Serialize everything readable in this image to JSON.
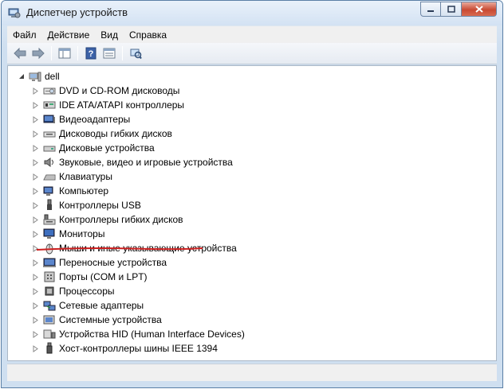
{
  "window": {
    "title": "Диспетчер устройств"
  },
  "menu": {
    "items": [
      "Файл",
      "Действие",
      "Вид",
      "Справка"
    ]
  },
  "toolbar": {
    "buttons": [
      "back-icon",
      "forward-icon",
      "console-tree-icon",
      "help-icon",
      "properties-icon",
      "scan-hardware-icon"
    ]
  },
  "tree": {
    "root": "dell",
    "items": [
      {
        "label": "DVD и CD-ROM дисководы",
        "icon": "dvd-drive-icon"
      },
      {
        "label": "IDE ATA/ATAPI контроллеры",
        "icon": "ide-controller-icon"
      },
      {
        "label": "Видеоадаптеры",
        "icon": "display-adapter-icon"
      },
      {
        "label": "Дисководы гибких дисков",
        "icon": "floppy-drive-icon"
      },
      {
        "label": "Дисковые устройства",
        "icon": "disk-drive-icon"
      },
      {
        "label": "Звуковые, видео и игровые устройства",
        "icon": "sound-icon"
      },
      {
        "label": "Клавиатуры",
        "icon": "keyboard-icon"
      },
      {
        "label": "Компьютер",
        "icon": "computer-icon"
      },
      {
        "label": "Контроллеры USB",
        "icon": "usb-icon"
      },
      {
        "label": "Контроллеры гибких дисков",
        "icon": "floppy-controller-icon"
      },
      {
        "label": "Мониторы",
        "icon": "monitor-icon"
      },
      {
        "label": "Мыши и иные указывающие устройства",
        "icon": "mouse-icon"
      },
      {
        "label": "Переносные устройства",
        "icon": "portable-device-icon"
      },
      {
        "label": "Порты (COM и LPT)",
        "icon": "port-icon"
      },
      {
        "label": "Процессоры",
        "icon": "processor-icon"
      },
      {
        "label": "Сетевые адаптеры",
        "icon": "network-adapter-icon"
      },
      {
        "label": "Системные устройства",
        "icon": "system-device-icon"
      },
      {
        "label": "Устройства HID (Human Interface Devices)",
        "icon": "hid-icon"
      },
      {
        "label": "Хост-контроллеры шины IEEE 1394",
        "icon": "ieee1394-icon"
      }
    ]
  },
  "colors": {
    "highlight_underline": "#cc1f1f",
    "title_bar": "#d3e2f3",
    "close_button": "#c94a33"
  }
}
